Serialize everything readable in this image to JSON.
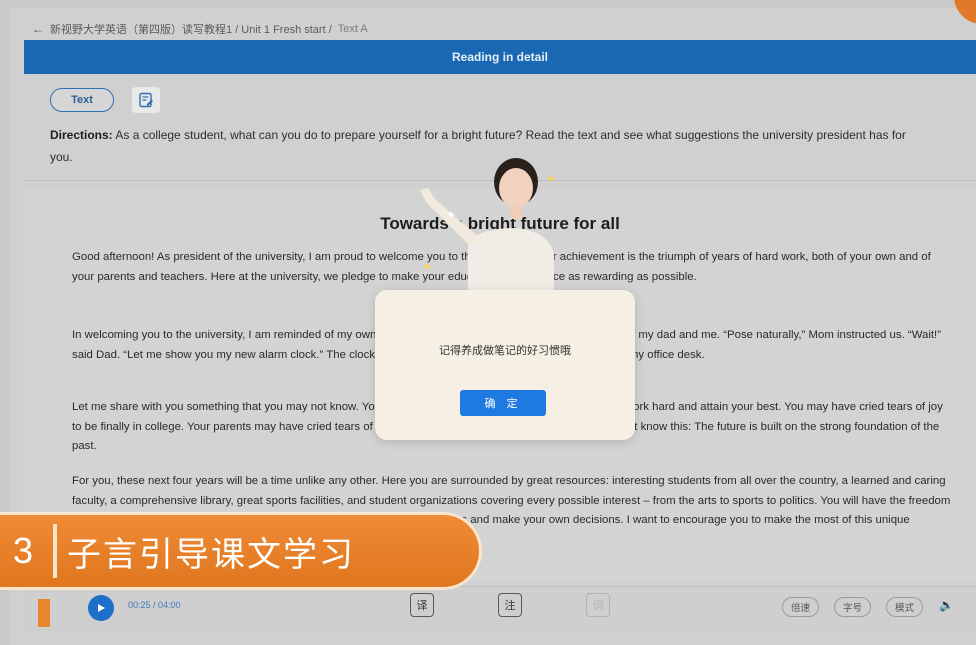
{
  "breadcrumb": {
    "back_icon": "arrow-left-icon",
    "path": "新视野大学英语（第四版）读写教程1 / Unit 1 Fresh start / ",
    "current": "Text A"
  },
  "header": {
    "title": "Reading in detail"
  },
  "toolbar": {
    "text_pill": "Text",
    "notes_icon": "notes-icon"
  },
  "directions": {
    "label": "Directions:",
    "text": " As a college student, what can you do to prepare yourself for a bright future? Read the text and see what suggestions the university president has for you."
  },
  "article": {
    "title": "Towards a bright future for all",
    "paragraphs": [
      "Good afternoon! As president of the university, I am proud to welcome you to the university. Your achievement is the triumph of years of hard work, both of your own and of your parents and teachers. Here at the university, we pledge to make your educational experience as rewarding as possible.",
      "In welcoming you to the university, I am reminded of my own first day of college – a photograph my mom took of my dad and me. “Pose naturally,” Mom instructed us. “Wait!” said Dad. “Let me show you my new alarm clock.” The clock woke me up every morning in college. It is still on my office desk.",
      "Let me share with you something that you may not know. You may have cried over your parents’ reminders to work hard and attain your best. You may have cried tears of joy to be finally in college. Your parents may have cried tears of joy to be finally finished with doing your laundry! But know this: The future is built on the strong foundation of the past.",
      "For you, these next four years will be a time unlike any other. Here you are surrounded by great resources: interesting students from all over the country, a learned and caring faculty, a comprehensive library, great sports facilities, and student organizations covering every possible interest – from the arts to sports to politics. You will have the freedom to explore and learn about new subjects. You will learn to get along with others and make your own decisions. I want to encourage you to make the most of this unique experience, and every opportunity."
    ]
  },
  "dialog": {
    "message": "记得养成做笔记的好习惯哦",
    "confirm": "确 定"
  },
  "player": {
    "time": "00:25 / 04:00",
    "tools": [
      "译",
      "注",
      "词"
    ],
    "right_controls": [
      "倍速",
      "字号",
      "模式"
    ],
    "speaker_icon": "speaker-icon"
  },
  "caption": {
    "number": "3",
    "text": "子言引导课文学习"
  },
  "colors": {
    "header_blue": "#1a68b3",
    "accent_orange": "#e0771f",
    "dialog_button": "#1e7ae0"
  }
}
